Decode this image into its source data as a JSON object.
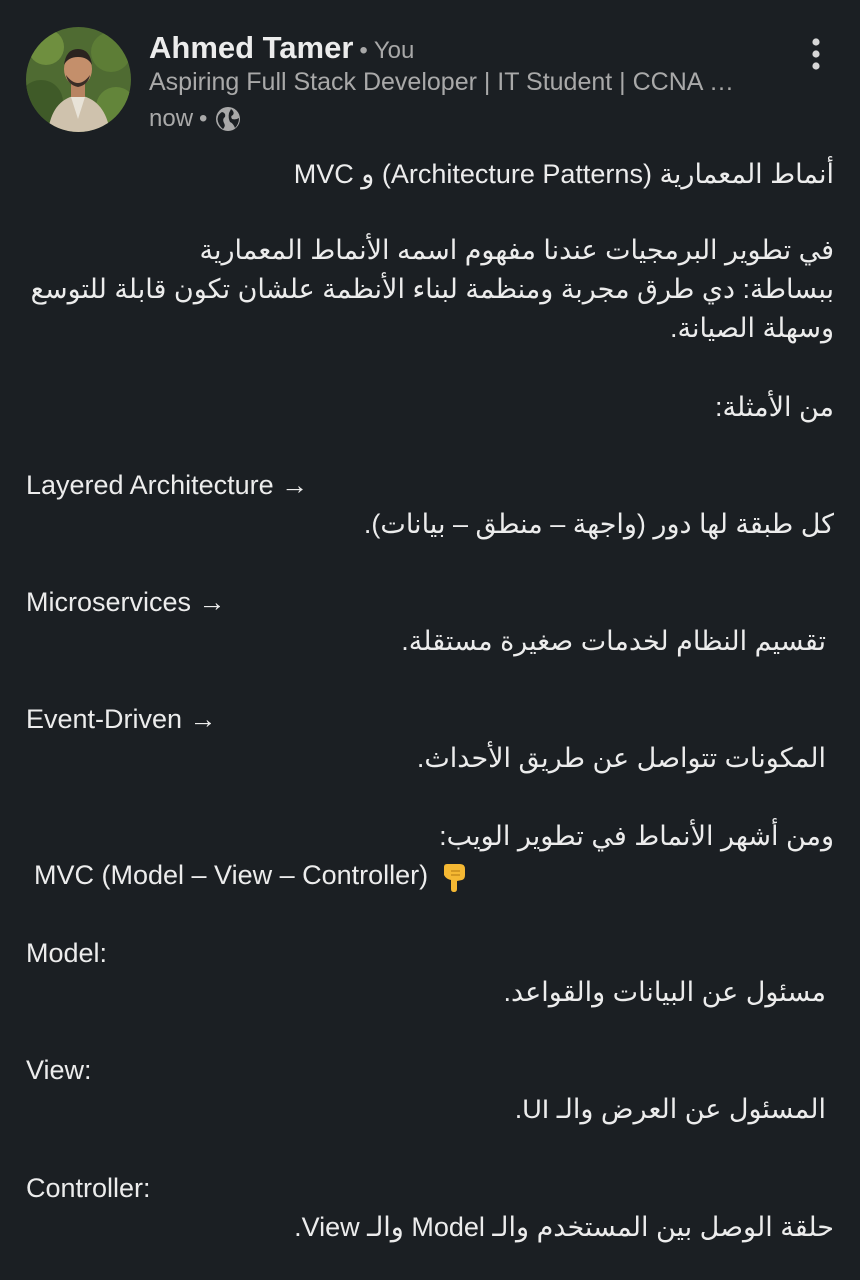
{
  "author": {
    "name": "Ahmed Tamer",
    "separator": "•",
    "badge": "You",
    "headline": "Aspiring Full Stack Developer | IT Student | CCNA …",
    "time": "now",
    "time_separator": "•",
    "visibility_icon": "globe-icon",
    "menu_icon": "more-vertical-icon"
  },
  "post": {
    "title": "أنماط المعمارية (Architecture Patterns) و MVC",
    "intro_1": "في تطوير البرمجيات عندنا مفهوم اسمه الأنماط المعمارية",
    "intro_2": "ببساطة: دي طرق مجربة ومنظمة لبناء الأنظمة علشان تكون قابلة للتوسع",
    "intro_3": "وسهلة الصيانة.",
    "examples_heading": "من الأمثلة:",
    "examples": [
      {
        "name": "Layered Architecture →",
        "desc": "كل طبقة لها دور (واجهة – منطق – بيانات)."
      },
      {
        "name": "Microservices →",
        "desc": "تقسيم النظام لخدمات صغيرة مستقلة."
      },
      {
        "name": "Event-Driven →",
        "desc": "المكونات تتواصل عن طريق الأحداث."
      }
    ],
    "web_heading": "ومن أشهر الأنماط في تطوير الويب:",
    "mvc_line": "MVC (Model – View – Controller)",
    "mvc_emoji": "pointing-down-hand-icon",
    "components": [
      {
        "name": "Model:",
        "desc": "مسئول عن البيانات والقواعد."
      },
      {
        "name": "View:",
        "desc": "المسئول عن العرض والـ UI."
      },
      {
        "name": "Controller:",
        "desc": "حلقة الوصل بين المستخدم والـ Model والـ View."
      }
    ]
  },
  "colors": {
    "background": "#1b1f23",
    "text": "#ececec",
    "muted": "#a9a9a9"
  }
}
